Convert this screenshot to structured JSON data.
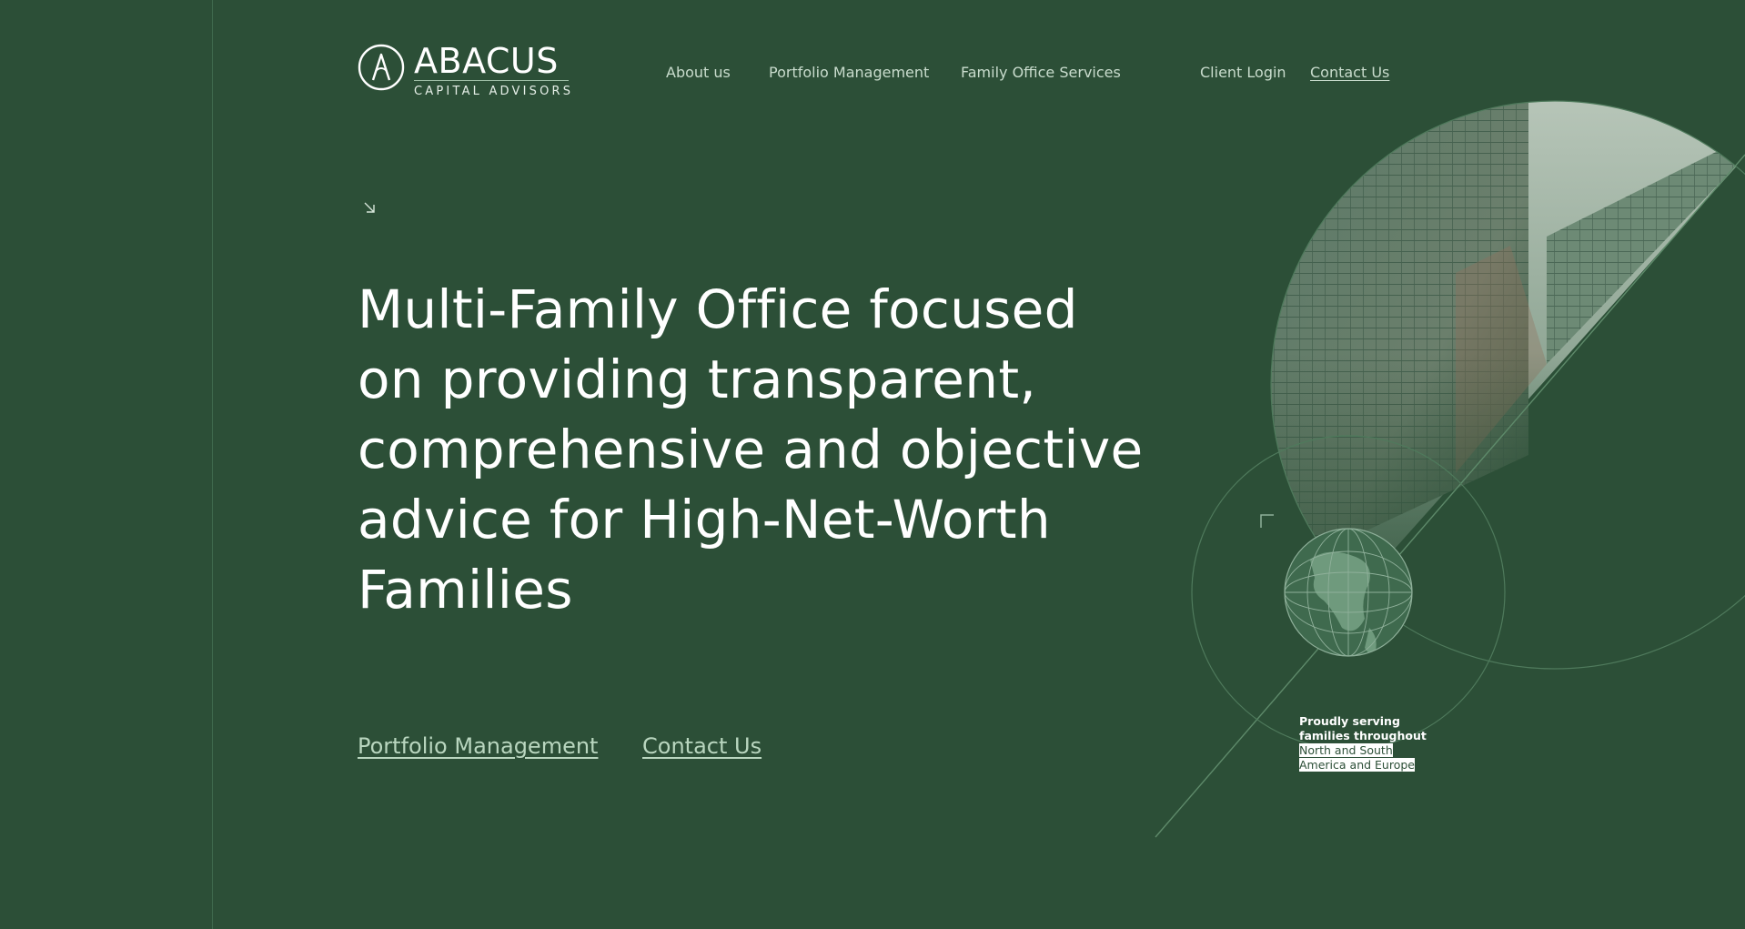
{
  "brand": {
    "name": "ABACUS",
    "subtitle": "CAPITAL ADVISORS"
  },
  "nav": {
    "about": "About us",
    "portfolio": "Portfolio Management",
    "family_office": "Family Office Services",
    "client_login": "Client Login",
    "contact": "Contact Us"
  },
  "hero": {
    "headline": "Multi-Family Office focused on providing transparent, comprehensive and objective advice for High-Net-Worth Families",
    "cta_portfolio": "Portfolio Management",
    "cta_contact": "Contact Us"
  },
  "serving": {
    "line1": "Proudly serving",
    "line2": "families throughout",
    "line3": "North and South",
    "line4": "America and Europe"
  },
  "colors": {
    "background": "#2c4f37",
    "accent_link": "#b9d6bf",
    "nav_text": "#c9dccd"
  },
  "icons": {
    "logo": "abacus-compass-logo",
    "arrow": "arrow-down-right-icon",
    "globe": "globe-icon"
  }
}
